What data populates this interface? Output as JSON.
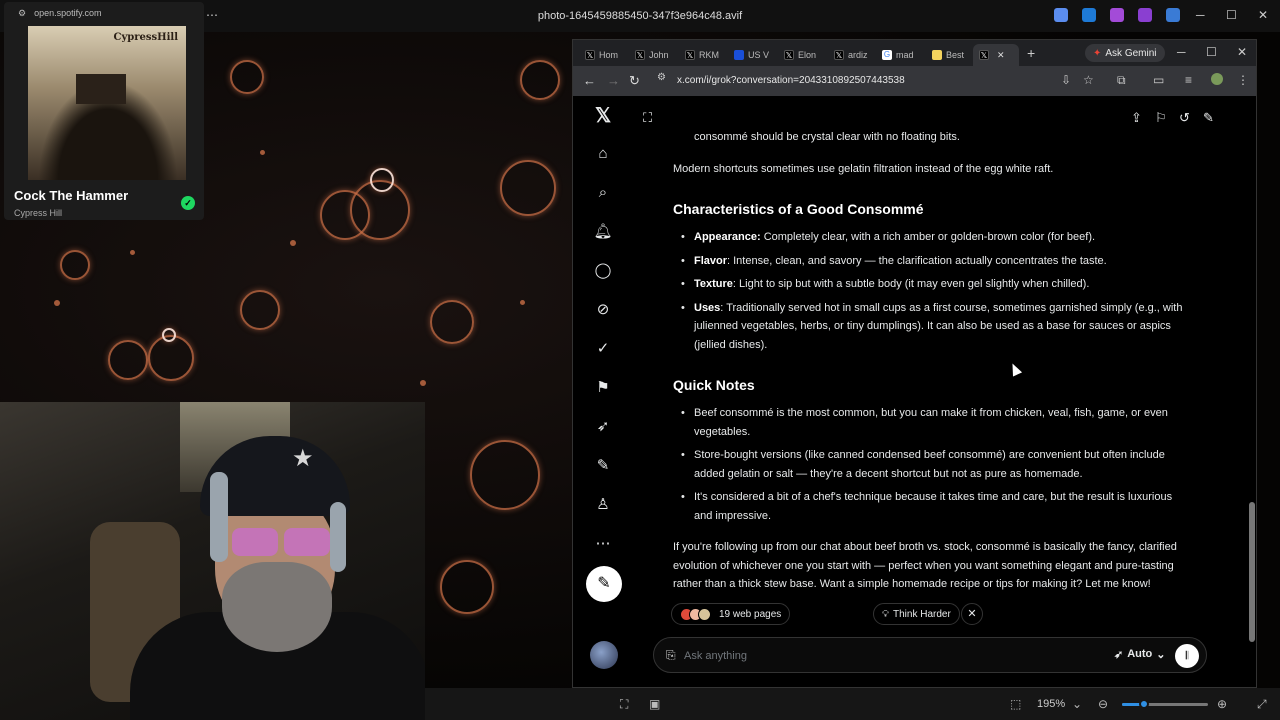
{
  "viewer": {
    "file_title": "photo-1645459885450-347f3e964c48.avif",
    "zoom": "195%"
  },
  "spotify": {
    "url": "open.spotify.com",
    "album_text": "CypressHill",
    "track": "Cock The Hammer",
    "artist": "Cypress Hill"
  },
  "browser": {
    "tabs": [
      {
        "label": "Hom",
        "icon": "x-icon",
        "color": "#000"
      },
      {
        "label": "John",
        "icon": "x-icon",
        "color": "#000"
      },
      {
        "label": "RKM",
        "icon": "x-icon",
        "color": "#000"
      },
      {
        "label": "US V",
        "icon": "site-icon",
        "color": "#1a4fd8"
      },
      {
        "label": "Elon",
        "icon": "x-icon",
        "color": "#000"
      },
      {
        "label": "ardiz",
        "icon": "x-icon",
        "color": "#000"
      },
      {
        "label": "mad",
        "icon": "google-icon",
        "color": "#fff"
      },
      {
        "label": "Best",
        "icon": "site-icon",
        "color": "#f4d35e"
      },
      {
        "label": "",
        "icon": "x-icon",
        "color": "#000"
      }
    ],
    "ask_gemini": "Ask Gemini",
    "url": "x.com/i/grok?conversation=2043310892507443538"
  },
  "grok": {
    "intro_tail": "consommé should be crystal clear with no floating bits.",
    "shortcut": "Modern shortcuts sometimes use gelatin filtration instead of the egg white raft.",
    "h_characteristics": "Characteristics of a Good Consommé",
    "characteristics": [
      {
        "term": "Appearance:",
        "text": " Completely clear, with a rich amber or golden-brown color (for beef)."
      },
      {
        "term": "Flavor",
        "text": ": Intense, clean, and savory — the clarification actually concentrates the taste."
      },
      {
        "term": "Texture",
        "text": ": Light to sip but with a subtle body (it may even gel slightly when chilled)."
      },
      {
        "term": "Uses",
        "text": ": Traditionally served hot in small cups as a first course, sometimes garnished simply (e.g., with julienned vegetables, herbs, or tiny dumplings). It can also be used as a base for sauces or aspics (jellied dishes)."
      }
    ],
    "h_notes": "Quick Notes",
    "notes": [
      "Beef consommé is the most common, but you can make it from chicken, veal, fish, game, or even vegetables.",
      "Store-bought versions (like canned condensed beef consommé) are convenient but often include added gelatin or salt — they're a decent shortcut but not as pure as homemade.",
      "It's considered a bit of a chef's technique because it takes time and care, but the result is luxurious and impressive."
    ],
    "closing": "If you're following up from our chat about beef broth vs. stock, consommé is basically the fancy, clarified evolution of whichever one you start with — perfect when you want something elegant and pure-tasting rather than a thick stew base. Want a simple homemade recipe or tips for making it? Let me know!",
    "sources": "19 web pages",
    "think_harder": "Think Harder",
    "ask_placeholder": "Ask anything",
    "mode": "Auto"
  }
}
